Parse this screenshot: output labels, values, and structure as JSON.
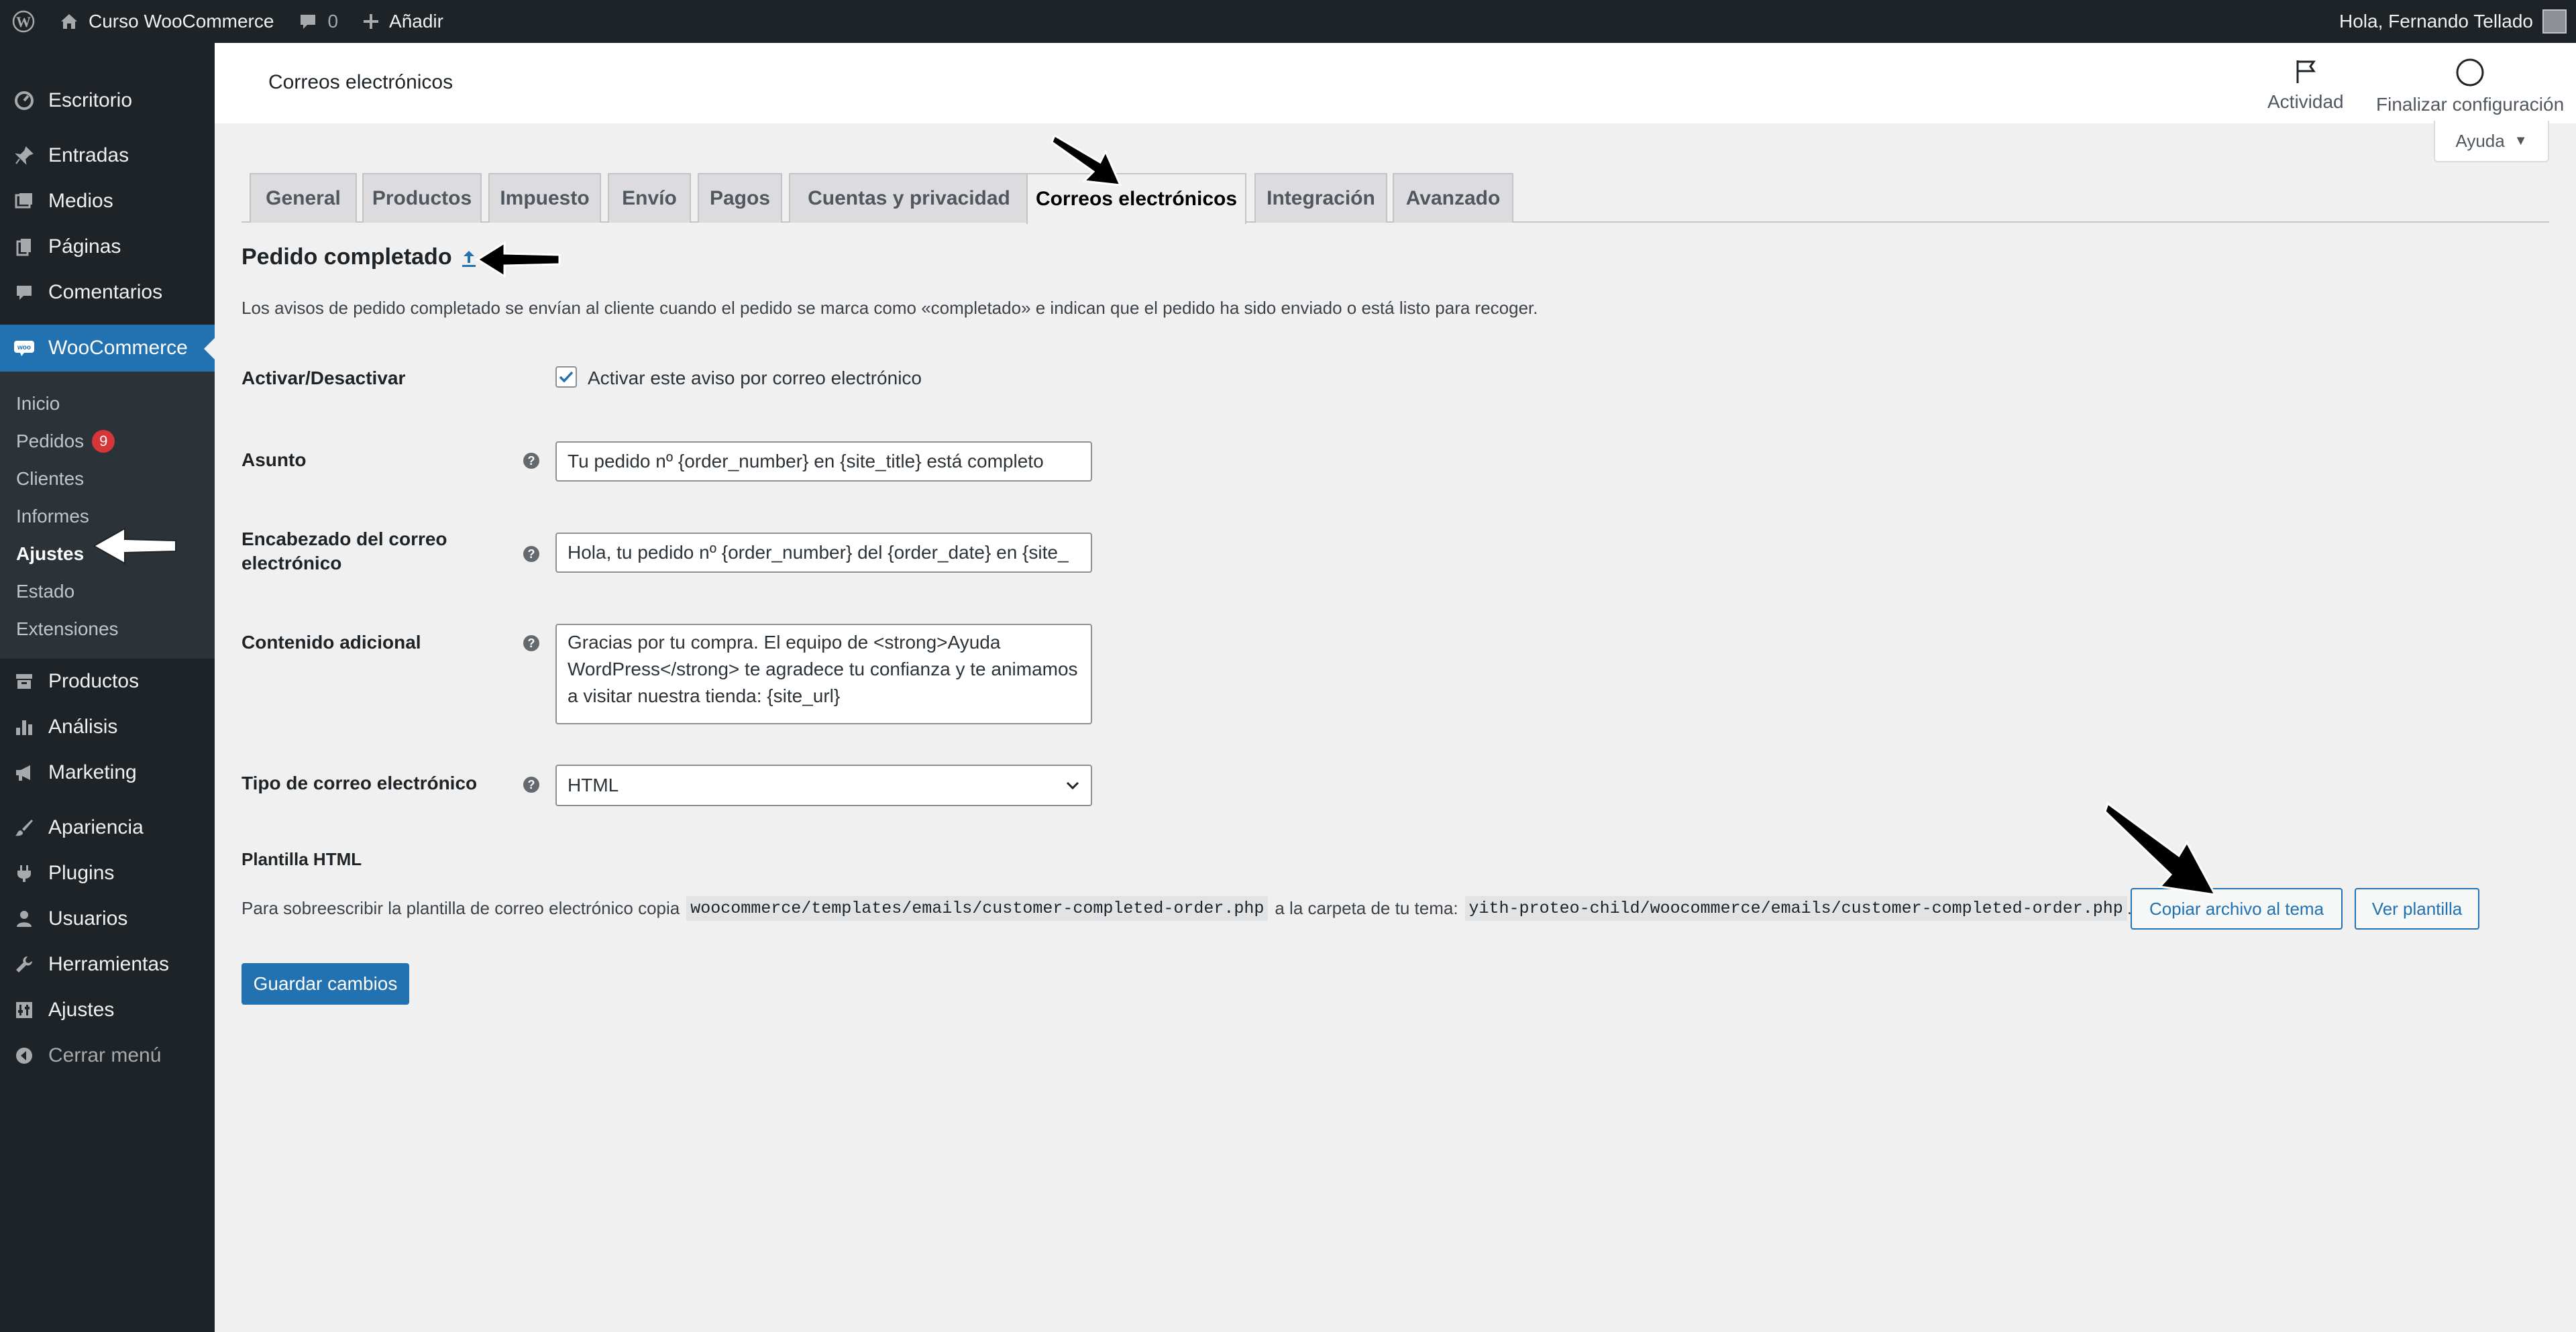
{
  "adminbar": {
    "site_name": "Curso WooCommerce",
    "comments_count": "0",
    "add_new": "Añadir",
    "greeting": "Hola, Fernando Tellado"
  },
  "sidebar": {
    "items_top": [
      {
        "label": "Escritorio",
        "icon": "dashboard-icon"
      },
      {
        "label": "Entradas",
        "icon": "pin-icon"
      },
      {
        "label": "Medios",
        "icon": "media-icon"
      },
      {
        "label": "Páginas",
        "icon": "pages-icon"
      },
      {
        "label": "Comentarios",
        "icon": "comments-icon"
      }
    ],
    "woocommerce": {
      "label": "WooCommerce",
      "icon": "woo-icon"
    },
    "submenu": [
      {
        "label": "Inicio"
      },
      {
        "label": "Pedidos",
        "badge": "9"
      },
      {
        "label": "Clientes"
      },
      {
        "label": "Informes"
      },
      {
        "label": "Ajustes"
      },
      {
        "label": "Estado"
      },
      {
        "label": "Extensiones"
      }
    ],
    "items_bottom": [
      {
        "label": "Productos",
        "icon": "archive-icon"
      },
      {
        "label": "Análisis",
        "icon": "bar-chart-icon"
      },
      {
        "label": "Marketing",
        "icon": "megaphone-icon"
      },
      {
        "label": "Apariencia",
        "icon": "brush-icon"
      },
      {
        "label": "Plugins",
        "icon": "plugin-icon"
      },
      {
        "label": "Usuarios",
        "icon": "user-icon"
      },
      {
        "label": "Herramientas",
        "icon": "wrench-icon"
      },
      {
        "label": "Ajustes",
        "icon": "settings-icon"
      },
      {
        "label": "Cerrar menú",
        "icon": "collapse-icon"
      }
    ]
  },
  "header": {
    "title": "Correos electrónicos",
    "activity": "Actividad",
    "finish_setup": "Finalizar configuración",
    "help": "Ayuda"
  },
  "tabs": [
    {
      "label": "General"
    },
    {
      "label": "Productos"
    },
    {
      "label": "Impuesto"
    },
    {
      "label": "Envío"
    },
    {
      "label": "Pagos"
    },
    {
      "label": "Cuentas y privacidad"
    },
    {
      "label": "Correos electrónicos",
      "active": true
    },
    {
      "label": "Integración"
    },
    {
      "label": "Avanzado"
    }
  ],
  "section": {
    "title": "Pedido completado",
    "description": "Los avisos de pedido completado se envían al cliente cuando el pedido se marca como «completado» e indican que el pedido ha sido enviado o está listo para recoger."
  },
  "form": {
    "enable_label": "Activar/Desactivar",
    "enable_checkbox_label": "Activar este aviso por correo electrónico",
    "subject_label": "Asunto",
    "subject_value": "Tu pedido nº {order_number} en {site_title} está completo",
    "heading_label_line1": "Encabezado del correo",
    "heading_label_line2": "electrónico",
    "heading_value": "Hola, tu pedido nº {order_number} del {order_date} en {site_",
    "additional_label": "Contenido adicional",
    "additional_value": "Gracias por tu compra. El equipo de <strong>Ayuda WordPress</strong> te agradece tu confianza y te animamos a visitar nuestra tienda: {site_url}",
    "email_type_label": "Tipo de correo electrónico",
    "email_type_value": "HTML"
  },
  "template": {
    "title": "Plantilla HTML",
    "text_before": "Para sobreescribir la plantilla de correo electrónico copia",
    "source_path": "woocommerce/templates/emails/customer-completed-order.php",
    "text_middle": "a la carpeta de tu tema:",
    "dest_path": "yith-proteo-child/woocommerce/emails/customer-completed-order.php",
    "text_after": ".",
    "copy_button": "Copiar archivo al tema",
    "view_button": "Ver plantilla"
  },
  "save_button": "Guardar cambios"
}
